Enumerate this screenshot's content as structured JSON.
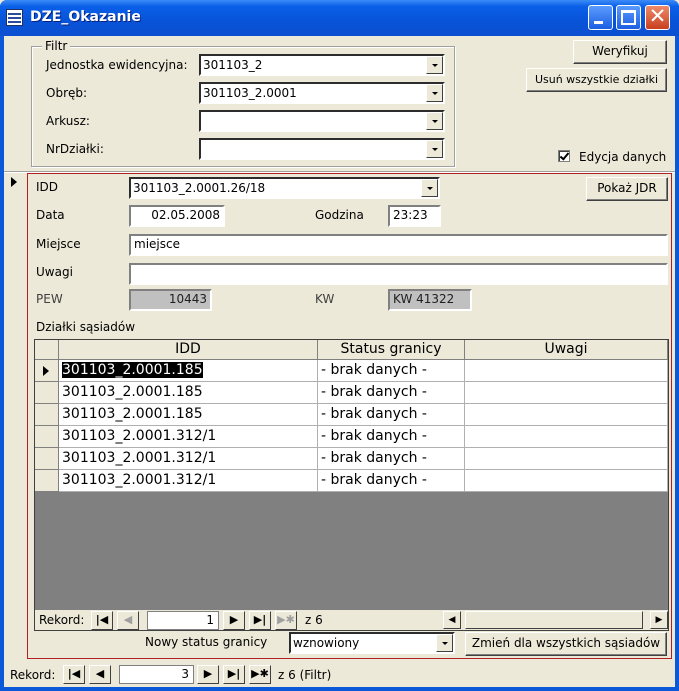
{
  "window": {
    "title": "DZE_Okazanie",
    "app_icon": "table-grid-icon",
    "controls": {
      "minimize": "minimize-icon",
      "maximize": "maximize-icon",
      "close": "close-icon",
      "close_glyph": "✕"
    }
  },
  "filter": {
    "legend": "Filtr",
    "jednostka_label": "Jednostka ewidencyjna:",
    "jednostka_value": "301103_2",
    "obreb_label": "Obręb:",
    "obreb_value": "301103_2.0001",
    "arkusz_label": "Arkusz:",
    "arkusz_value": "",
    "nrdzialki_label": "NrDziałki:",
    "nrdzialki_value": ""
  },
  "buttons": {
    "weryfikuj": "Weryfikuj",
    "usun": "Usuń wszystkie działki",
    "pokaz_jdr": "Pokaż JDR",
    "zmien": "Zmień dla wszystkich sąsiadów"
  },
  "edycja": {
    "label": "Edycja danych",
    "checked": true
  },
  "record": {
    "idd_label": "IDD",
    "idd_value": "301103_2.0001.26/18",
    "data_label": "Data",
    "data_value": "02.05.2008",
    "godzina_label": "Godzina",
    "godzina_value": "23:23",
    "miejsce_label": "Miejsce",
    "miejsce_value": "miejsce",
    "uwagi_label": "Uwagi",
    "uwagi_value": "",
    "pew_label": "PEW",
    "pew_value": "10443",
    "kw_label": "KW",
    "kw_value": "KW 41322"
  },
  "neighbors": {
    "label": "Działki sąsiadów",
    "columns": [
      "IDD",
      "Status granicy",
      "Uwagi"
    ],
    "rows": [
      {
        "idd": "301103_2.0001.185",
        "status": "- brak danych -",
        "uwagi": ""
      },
      {
        "idd": "301103_2.0001.185",
        "status": "- brak danych -",
        "uwagi": ""
      },
      {
        "idd": "301103_2.0001.185",
        "status": "- brak danych -",
        "uwagi": ""
      },
      {
        "idd": "301103_2.0001.312/1",
        "status": "- brak danych -",
        "uwagi": ""
      },
      {
        "idd": "301103_2.0001.312/1",
        "status": "- brak danych -",
        "uwagi": ""
      },
      {
        "idd": "301103_2.0001.312/1",
        "status": "- brak danych -",
        "uwagi": ""
      }
    ],
    "nav": {
      "label": "Rekord:",
      "current": "1",
      "of": "z 6"
    }
  },
  "status": {
    "label": "Nowy status granicy",
    "value": "wznowiony"
  },
  "main_nav": {
    "label": "Rekord:",
    "current": "3",
    "of": "z 6 (Filtr)"
  },
  "nav_glyphs": {
    "first": "|◀",
    "prev": "◀",
    "next": "▶",
    "last": "▶|",
    "new": "▶✱",
    "scroll_left": "◀",
    "scroll_right": "▶"
  }
}
